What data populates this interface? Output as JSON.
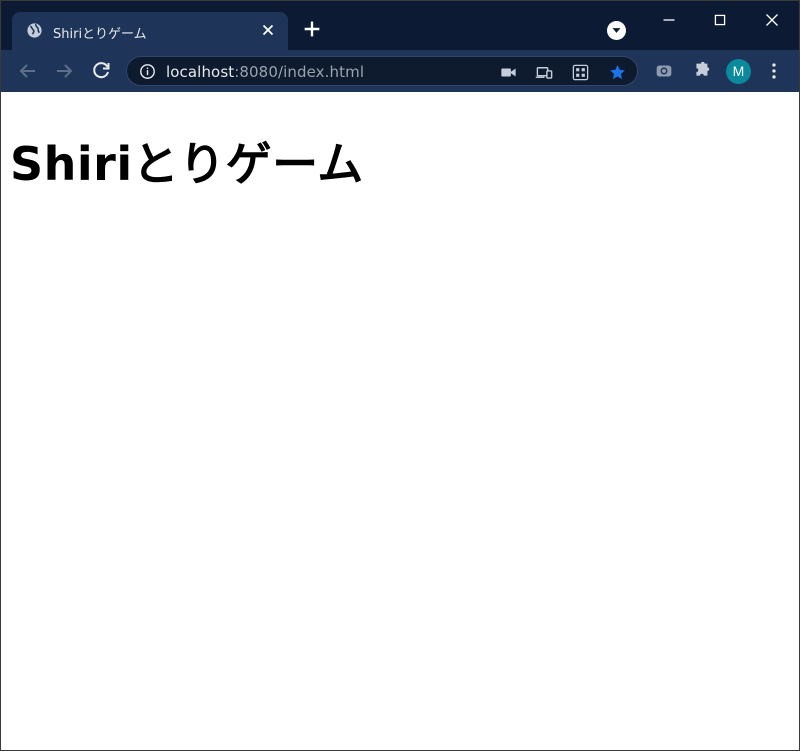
{
  "browser": {
    "tab": {
      "title": "Shiriとりゲーム",
      "favicon": "globe-icon"
    },
    "address_bar": {
      "host": "localhost",
      "path": ":8080/index.html"
    },
    "profile": {
      "initial": "M",
      "color": "#0a8a9c"
    },
    "colors": {
      "frame": "#0c1b33",
      "toolbar": "#1e3458",
      "bookmark_star": "#1a73e8"
    }
  },
  "page": {
    "heading": "Shiriとりゲーム"
  }
}
